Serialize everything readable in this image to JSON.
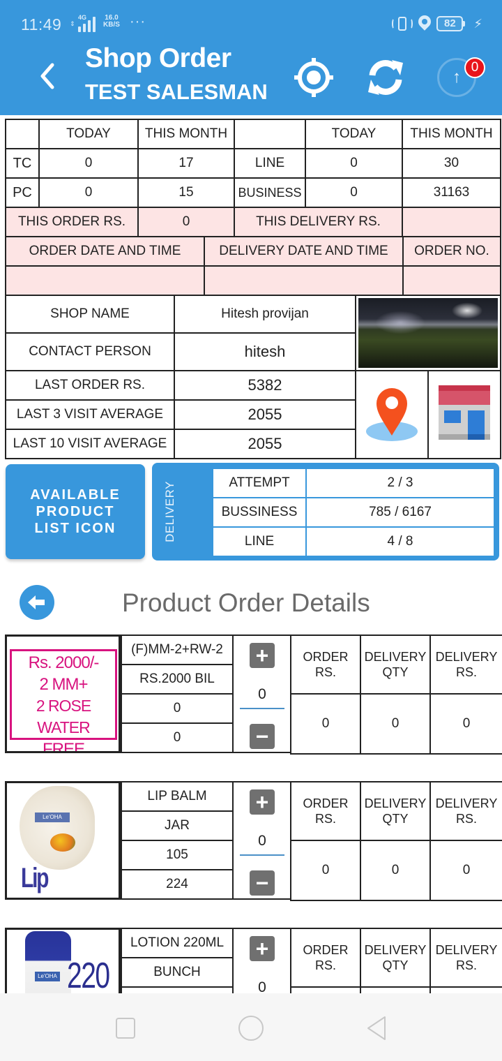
{
  "status_bar": {
    "time": "11:49",
    "network_type": "4G",
    "speed_value": "16.0",
    "speed_unit": "KB/S",
    "more": "···",
    "battery_level": "82",
    "charging_icon": "⚡"
  },
  "header": {
    "title": "Shop Order",
    "subtitle": "TEST SALESMAN",
    "upload_badge_count": "0",
    "upload_arrow": "↑",
    "colors": {
      "primary": "#3897dc",
      "badge": "#e8141b"
    }
  },
  "stats": {
    "col_today": "TODAY",
    "col_month": "THIS MONTH",
    "rows": [
      {
        "label": "TC",
        "today": "0",
        "month": "17",
        "label2": "LINE",
        "today2": "0",
        "month2": "30"
      },
      {
        "label": "PC",
        "today": "0",
        "month": "15",
        "label2": "BUSINESS",
        "today2": "0",
        "month2": "31163"
      }
    ],
    "this_order_label": "THIS ORDER RS.",
    "this_order_value": "0",
    "this_delivery_label": "THIS DELIVERY RS.",
    "this_delivery_value": ""
  },
  "dates": {
    "order_date_label": "ORDER DATE AND TIME",
    "delivery_date_label": "DELIVERY DATE AND TIME",
    "order_no_label": "ORDER NO.",
    "order_date_value": "",
    "delivery_date_value": "",
    "order_no_value": ""
  },
  "shop": {
    "rows": [
      {
        "label": "SHOP NAME",
        "value": "Hitesh provijan"
      },
      {
        "label": "CONTACT PERSON",
        "value": "hitesh"
      },
      {
        "label": "LAST ORDER RS.",
        "value": "5382"
      },
      {
        "label": "LAST 3 VISIT AVERAGE",
        "value": "2055"
      },
      {
        "label": "LAST 10 VISIT AVERAGE",
        "value": "2055"
      }
    ]
  },
  "available_button": {
    "label": "AVAILABLE\nPRODUCT\nLIST ICON"
  },
  "delivery": {
    "side_label": "DELIVERY",
    "rows": [
      {
        "label": "ATTEMPT",
        "value": "2 / 3"
      },
      {
        "label": "BUSSINESS",
        "value": "785 / 6167"
      },
      {
        "label": "LINE",
        "value": "4 / 8"
      }
    ]
  },
  "product_details": {
    "title": "Product Order Details",
    "headers": {
      "order_rs": "ORDER RS.",
      "delivery_qty": "DELIVERY QTY",
      "delivery_rs": "DELIVERY RS."
    },
    "plus": "+",
    "minus": "−",
    "products": [
      {
        "image_text": [
          "Rs. 2000/-",
          "2 MM+",
          "2 ROSE WATER",
          "FREE"
        ],
        "name": "(F)MM-2+RW-2",
        "unit": "RS.2000 BIL",
        "field3": "0",
        "field4": "0",
        "qty": "0",
        "order_rs": "0",
        "delivery_qty": "0",
        "delivery_rs": "0"
      },
      {
        "image_text": [
          "Lip Balm"
        ],
        "image_brand": "Le'OHA",
        "name": "LIP BALM",
        "unit": "JAR",
        "field3": "105",
        "field4": "224",
        "qty": "0",
        "order_rs": "0",
        "delivery_qty": "0",
        "delivery_rs": "0"
      },
      {
        "image_text": [
          "220"
        ],
        "image_brand": "Le'OHA",
        "name": "LOTION 220ML",
        "unit": "BUNCH",
        "field3": "",
        "field4": "",
        "qty": "0",
        "order_rs": "",
        "delivery_qty": "",
        "delivery_rs": ""
      }
    ]
  }
}
